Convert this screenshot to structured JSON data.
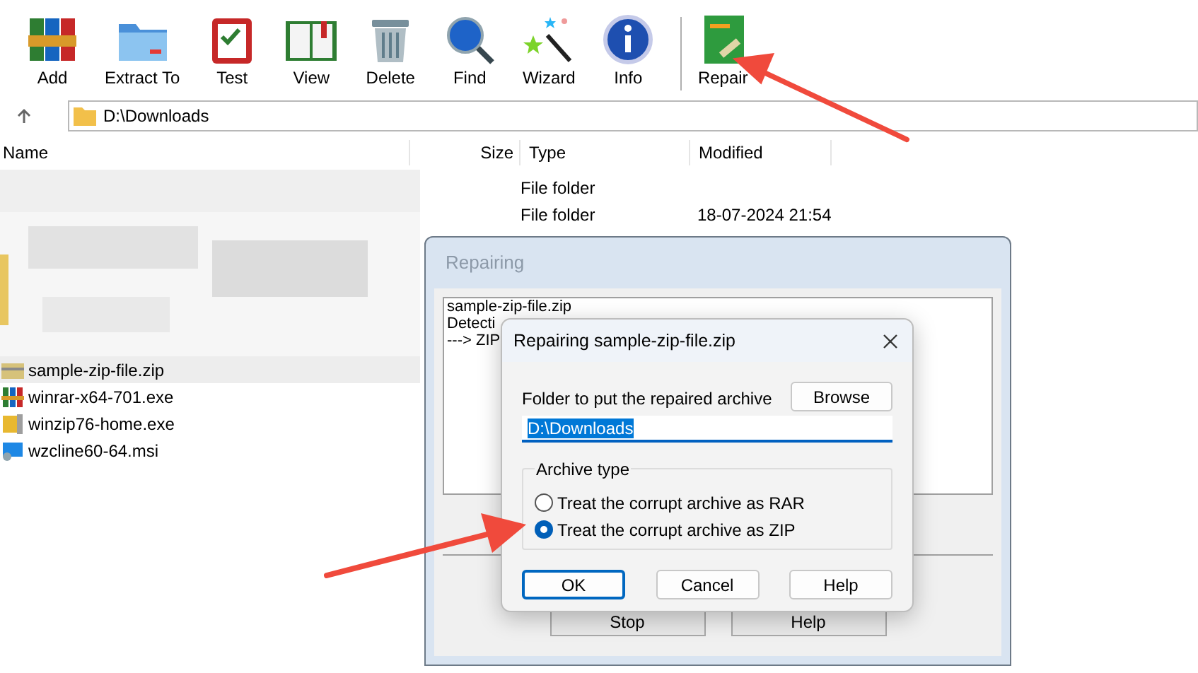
{
  "toolbar": [
    {
      "label": "Add",
      "kind": "books"
    },
    {
      "label": "Extract To",
      "kind": "folder"
    },
    {
      "label": "Test",
      "kind": "clipboard"
    },
    {
      "label": "View",
      "kind": "book"
    },
    {
      "label": "Delete",
      "kind": "trash"
    },
    {
      "label": "Find",
      "kind": "magnifier"
    },
    {
      "label": "Wizard",
      "kind": "wand"
    },
    {
      "label": "Info",
      "kind": "info"
    },
    {
      "label": "Repair",
      "kind": "repair",
      "separated": true
    }
  ],
  "address": {
    "path": "D:\\Downloads"
  },
  "columns": {
    "name": "Name",
    "size": "Size",
    "type": "Type",
    "modified": "Modified"
  },
  "folder_rows": [
    {
      "type": "File folder"
    },
    {
      "type": "File folder",
      "modified": "18-07-2024 21:54"
    }
  ],
  "files": [
    {
      "name": "sample-zip-file.zip",
      "kind": "zip",
      "selected": true
    },
    {
      "name": "winrar-x64-701.exe",
      "kind": "winrar",
      "selected": false
    },
    {
      "name": "winzip76-home.exe",
      "kind": "winzip",
      "selected": false
    },
    {
      "name": "wzcline60-64.msi",
      "kind": "msi",
      "selected": false
    }
  ],
  "repairing_window": {
    "title": "Repairing",
    "log": [
      "sample-zip-file.zip",
      "Detecti",
      "---> ZIP"
    ],
    "buttons": [
      "Stop",
      "Help"
    ]
  },
  "dialog": {
    "title": "Repairing sample-zip-file.zip",
    "folder_label": "Folder to put the repaired archive",
    "browse": "Browse",
    "folder_value": "D:\\Downloads",
    "group_label": "Archive type",
    "options": [
      {
        "label": "Treat the corrupt archive as RAR",
        "selected": false
      },
      {
        "label": "Treat the corrupt archive as ZIP",
        "selected": true
      }
    ],
    "buttons": [
      {
        "label": "OK",
        "default": true
      },
      {
        "label": "Cancel",
        "default": false
      },
      {
        "label": "Help",
        "default": false
      }
    ]
  }
}
